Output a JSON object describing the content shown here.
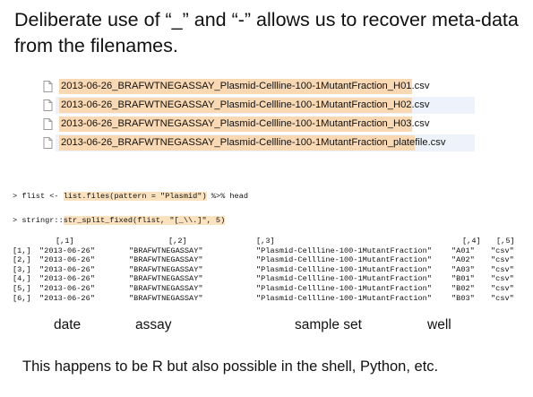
{
  "title": "Deliberate use of “_” and “-” allows us to recover meta-data from the filenames.",
  "files": [
    {
      "stem": "2013-06-26_BRAFWTNEGASSAY_Plasmid-Cellline-100-1MutantFraction_H01",
      "ext": ".csv"
    },
    {
      "stem": "2013-06-26_BRAFWTNEGASSAY_Plasmid-Cellline-100-1MutantFraction_H02",
      "ext": ".csv"
    },
    {
      "stem": "2013-06-26_BRAFWTNEGASSAY_Plasmid-Cellline-100-1MutantFraction_H03",
      "ext": ".csv"
    },
    {
      "stem": "2013-06-26_BRAFWTNEGASSAY_Plasmid-Cellline-100-1MutantFraction_plate",
      "ext": "file.csv"
    }
  ],
  "console": {
    "cmd1_prompt": "> flist <- ",
    "cmd1_hl": "list.files(pattern = \"Plasmid\")",
    "cmd1_rest": " %>% head",
    "cmd2_prompt": "> stringr::",
    "cmd2_hl": "str_split_fixed(flist, \"[_\\\\.]\", 5)",
    "cmd2_rest": "",
    "col_headers": [
      "",
      "[,1]",
      "[,2]",
      "[,3]",
      "[,4]",
      "[,5]"
    ],
    "rows": [
      [
        "[1,]",
        "\"2013-06-26\"",
        "\"BRAFWTNEGASSAY\"",
        "\"Plasmid-Cellline-100-1MutantFraction\"",
        "\"A01\"",
        "\"csv\""
      ],
      [
        "[2,]",
        "\"2013-06-26\"",
        "\"BRAFWTNEGASSAY\"",
        "\"Plasmid-Cellline-100-1MutantFraction\"",
        "\"A02\"",
        "\"csv\""
      ],
      [
        "[3,]",
        "\"2013-06-26\"",
        "\"BRAFWTNEGASSAY\"",
        "\"Plasmid-Cellline-100-1MutantFraction\"",
        "\"A03\"",
        "\"csv\""
      ],
      [
        "[4,]",
        "\"2013-06-26\"",
        "\"BRAFWTNEGASSAY\"",
        "\"Plasmid-Cellline-100-1MutantFraction\"",
        "\"B01\"",
        "\"csv\""
      ],
      [
        "[5,]",
        "\"2013-06-26\"",
        "\"BRAFWTNEGASSAY\"",
        "\"Plasmid-Cellline-100-1MutantFraction\"",
        "\"B02\"",
        "\"csv\""
      ],
      [
        "[6,]",
        "\"2013-06-26\"",
        "\"BRAFWTNEGASSAY\"",
        "\"Plasmid-Cellline-100-1MutantFraction\"",
        "\"B03\"",
        "\"csv\""
      ]
    ]
  },
  "labels": {
    "date": "date",
    "assay": "assay",
    "sample_set": "sample set",
    "well": "well"
  },
  "footer": "This happens to be R but also possible in the shell, Python, etc.",
  "colors": {
    "highlight": "#f9d9b3",
    "stripe": "#eef3fb"
  },
  "icons": {
    "file": "document-icon"
  }
}
